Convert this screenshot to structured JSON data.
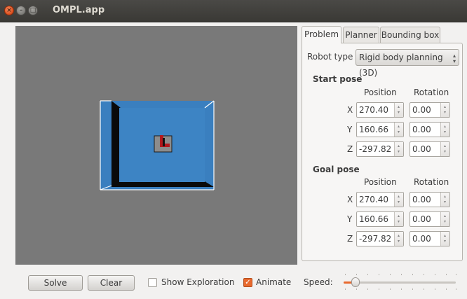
{
  "window": {
    "title": "OMPL.app"
  },
  "tabs": [
    {
      "label": "Problem",
      "active": true
    },
    {
      "label": "Planner",
      "active": false
    },
    {
      "label": "Bounding box",
      "active": false
    }
  ],
  "problem": {
    "robot_type_label": "Robot type",
    "robot_type_value": "Rigid body planning (3D)",
    "start_pose": {
      "heading": "Start pose",
      "position_header": "Position",
      "rotation_header": "Rotation",
      "rows": [
        {
          "axis": "X",
          "position": "270.40",
          "rotation": "0.00"
        },
        {
          "axis": "Y",
          "position": "160.66",
          "rotation": "0.00"
        },
        {
          "axis": "Z",
          "position": "-297.82",
          "rotation": "0.00"
        }
      ]
    },
    "goal_pose": {
      "heading": "Goal pose",
      "position_header": "Position",
      "rotation_header": "Rotation",
      "rows": [
        {
          "axis": "X",
          "position": "270.40",
          "rotation": "0.00"
        },
        {
          "axis": "Y",
          "position": "160.66",
          "rotation": "0.00"
        },
        {
          "axis": "Z",
          "position": "-297.82",
          "rotation": "0.00"
        }
      ]
    }
  },
  "controls": {
    "solve_label": "Solve",
    "clear_label": "Clear",
    "show_exploration_label": "Show Exploration",
    "show_exploration_checked": false,
    "animate_label": "Animate",
    "animate_checked": true,
    "speed_label": "Speed:",
    "speed_level": 0.1
  },
  "colors": {
    "viewport_bg": "#797979",
    "environment_blue": "#3a7fbf",
    "robot_red": "#b3181c",
    "accent_orange": "#e8692e"
  }
}
